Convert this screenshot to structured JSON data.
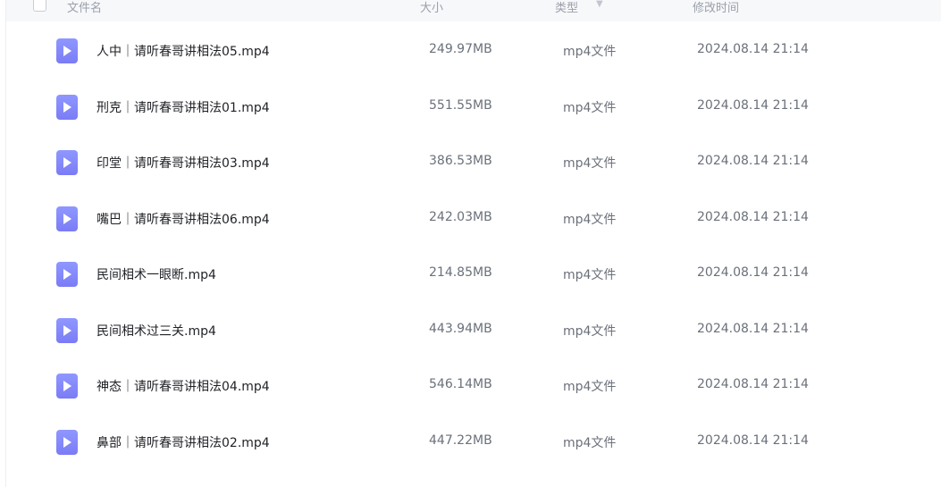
{
  "header": {
    "name_label": "文件名",
    "size_label": "大小",
    "type_label": "类型",
    "modified_label": "修改时间"
  },
  "files": [
    {
      "name": "人中｜请听春哥讲相法05.mp4",
      "size": "249.97MB",
      "type": "mp4文件",
      "modified": "2024.08.14 21:14",
      "icon": "video-file-icon"
    },
    {
      "name": "刑克｜请听春哥讲相法01.mp4",
      "size": "551.55MB",
      "type": "mp4文件",
      "modified": "2024.08.14 21:14",
      "icon": "video-file-icon"
    },
    {
      "name": "印堂｜请听春哥讲相法03.mp4",
      "size": "386.53MB",
      "type": "mp4文件",
      "modified": "2024.08.14 21:14",
      "icon": "video-file-icon"
    },
    {
      "name": "嘴巴｜请听春哥讲相法06.mp4",
      "size": "242.03MB",
      "type": "mp4文件",
      "modified": "2024.08.14 21:14",
      "icon": "video-file-icon"
    },
    {
      "name": "民间相术一眼断.mp4",
      "size": "214.85MB",
      "type": "mp4文件",
      "modified": "2024.08.14 21:14",
      "icon": "video-file-icon"
    },
    {
      "name": "民间相术过三关.mp4",
      "size": "443.94MB",
      "type": "mp4文件",
      "modified": "2024.08.14 21:14",
      "icon": "video-file-icon"
    },
    {
      "name": "神态｜请听春哥讲相法04.mp4",
      "size": "546.14MB",
      "type": "mp4文件",
      "modified": "2024.08.14 21:14",
      "icon": "video-file-icon"
    },
    {
      "name": "鼻部｜请听春哥讲相法02.mp4",
      "size": "447.22MB",
      "type": "mp4文件",
      "modified": "2024.08.14 21:14",
      "icon": "video-file-icon"
    }
  ]
}
